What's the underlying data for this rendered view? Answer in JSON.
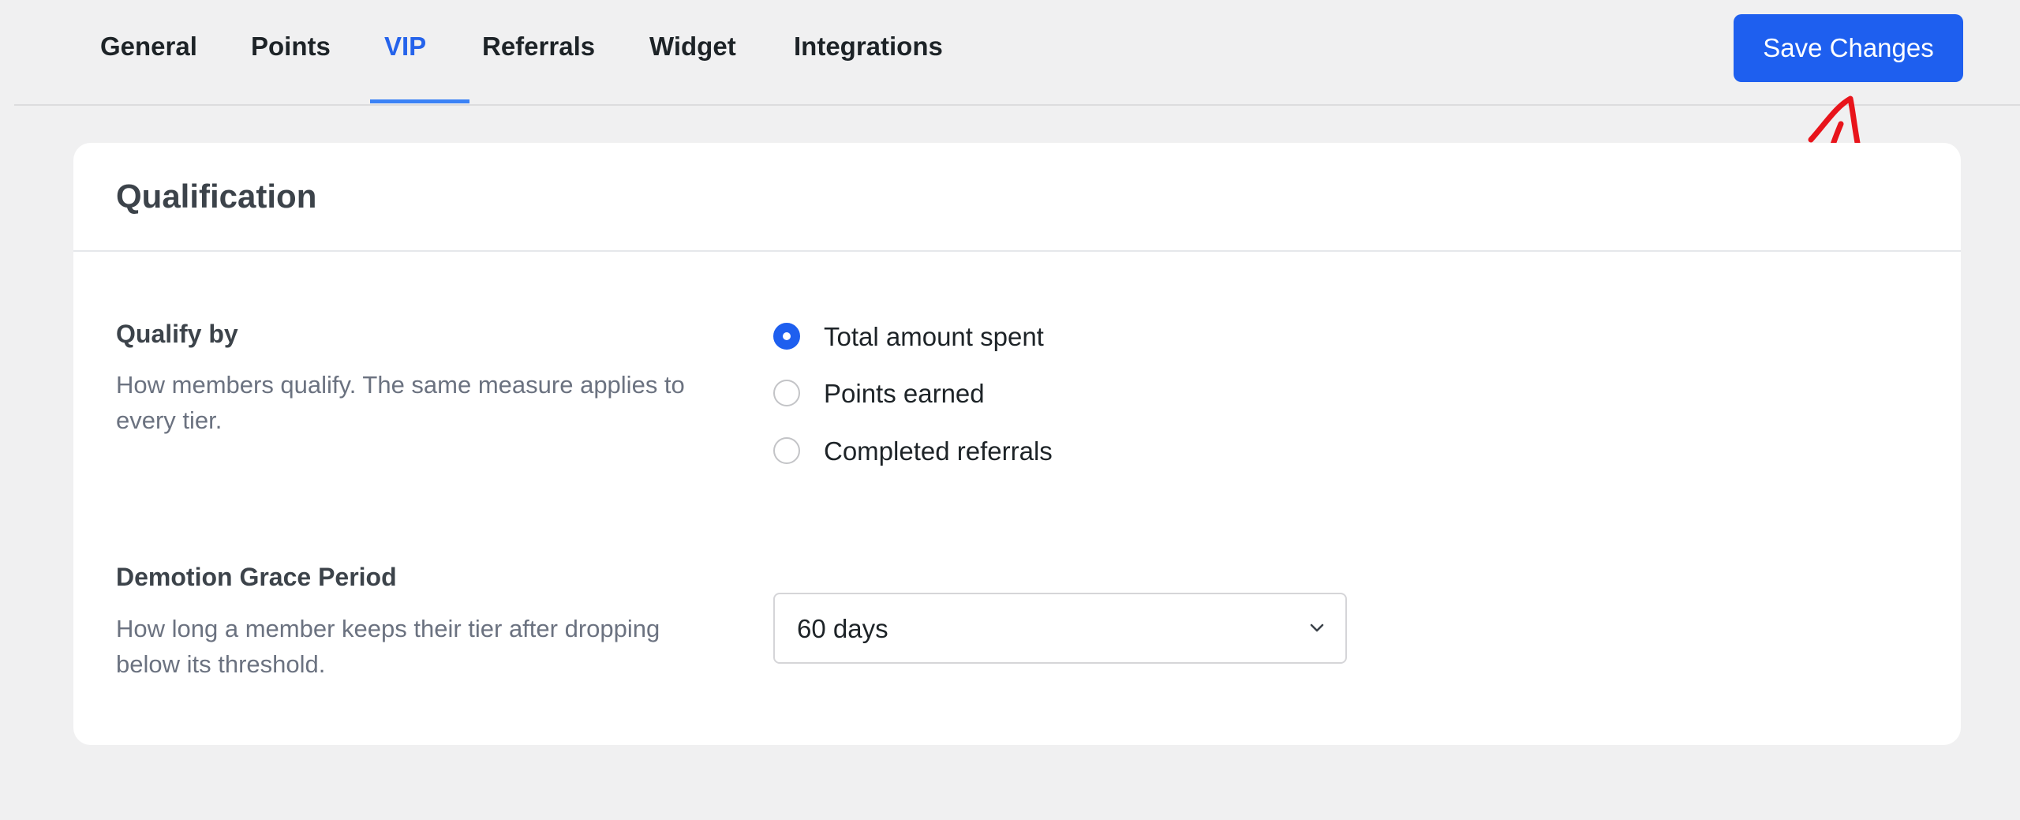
{
  "tabs": [
    {
      "label": "General",
      "active": false
    },
    {
      "label": "Points",
      "active": false
    },
    {
      "label": "VIP",
      "active": true
    },
    {
      "label": "Referrals",
      "active": false
    },
    {
      "label": "Widget",
      "active": false
    },
    {
      "label": "Integrations",
      "active": false
    }
  ],
  "toolbar": {
    "save_label": "Save Changes"
  },
  "colors": {
    "accent": "#1e5fef",
    "active_tab": "#2563eb",
    "annotation": "#e8141b",
    "background": "#f0f0f1"
  },
  "card": {
    "title": "Qualification",
    "qualify": {
      "label": "Qualify by",
      "description": "How members qualify. The same measure applies to every tier.",
      "options": [
        {
          "label": "Total amount spent",
          "selected": true
        },
        {
          "label": "Points earned",
          "selected": false
        },
        {
          "label": "Completed referrals",
          "selected": false
        }
      ]
    },
    "grace": {
      "label": "Demotion Grace Period",
      "description": "How long a member keeps their tier after dropping below its threshold.",
      "selected_value": "60 days"
    }
  },
  "icons": {
    "dropdown": "chevron-down-icon",
    "annotation": "red-arrow-annotation"
  }
}
